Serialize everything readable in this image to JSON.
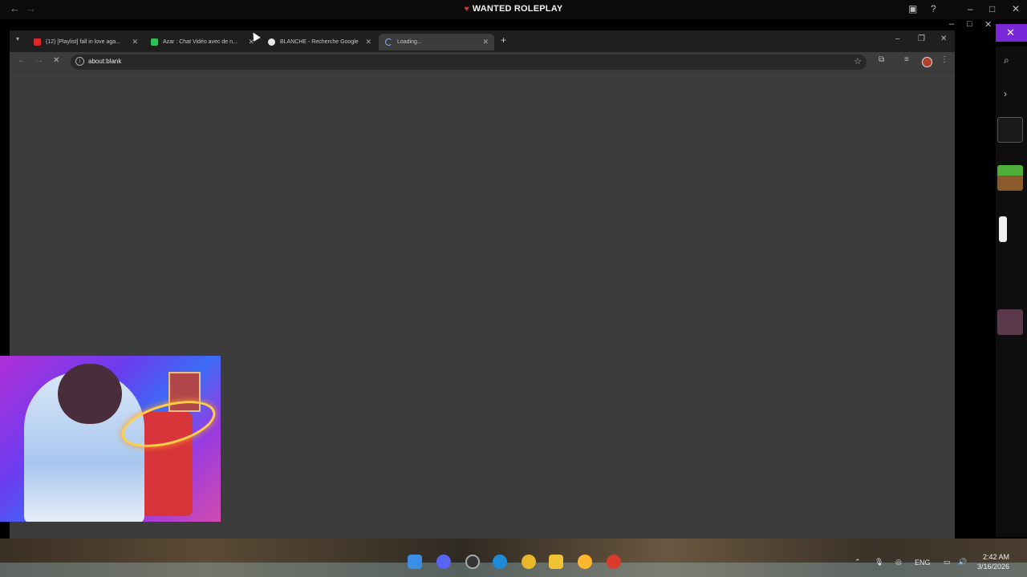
{
  "launcher": {
    "title": "WANTED ROLEPLAY",
    "back_icon": "arrow-left-icon",
    "forward_icon": "arrow-right-icon"
  },
  "browser": {
    "tabs": [
      {
        "label": "(12) [Playlist] fall in love aga...",
        "favicon_color": "#e0262b",
        "active": false
      },
      {
        "label": "Azar : Chat Vidéo avec de n...",
        "favicon_color": "#2fc05a",
        "active": false
      },
      {
        "label": "BLANCHE - Recherche Google",
        "favicon_color": "#e9e9e9",
        "active": false
      },
      {
        "label": "Loading...",
        "favicon_color": "#8ab4f8",
        "active": true
      }
    ],
    "new_tab_label": "+",
    "url": "about:blank"
  },
  "taskbar": {
    "language": "ENG",
    "time": "2:42 AM",
    "date": "3/16/2026",
    "inner_time": "2:42 AM",
    "inner_date": "3/16/2026"
  },
  "colors": {
    "accent_purple": "#7a27d9",
    "page_background": "#3c3c3c",
    "brand_red": "#e0322e"
  }
}
